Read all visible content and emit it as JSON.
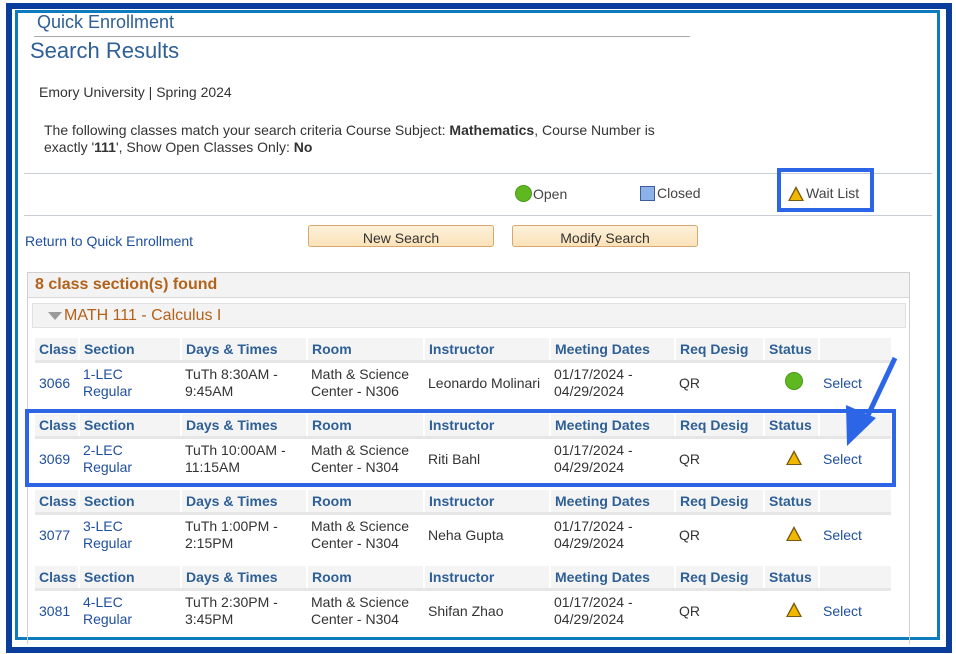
{
  "header": {
    "app_title": "Quick Enrollment",
    "page_title": "Search Results",
    "institution_term": "Emory University | Spring 2024"
  },
  "criteria": {
    "prefix": "The following classes match your search criteria Course Subject: ",
    "subject": "Mathematics",
    "mid": ",  Course Number is exactly '",
    "course_number": "111",
    "mid2": "',  Show Open Classes Only: ",
    "open_only": "No"
  },
  "legend": {
    "open": {
      "label": "Open",
      "icon": "green-circle-icon",
      "color": "#5fb820"
    },
    "closed": {
      "label": "Closed",
      "icon": "blue-square-icon",
      "color": "#8db2e8"
    },
    "waitlist": {
      "label": "Wait List",
      "icon": "yellow-triangle-icon",
      "color": "#f2b800"
    }
  },
  "actions": {
    "return_link": "Return to Quick Enrollment",
    "new_search": "New Search",
    "modify_search": "Modify Search"
  },
  "results": {
    "count_label": "8 class section(s) found",
    "course_title": "MATH 111 - Calculus I",
    "columns": [
      "Class",
      "Section",
      "Days & Times",
      "Room",
      "Instructor",
      "Meeting Dates",
      "Req Desig",
      "Status",
      ""
    ],
    "sections": [
      {
        "class_nbr": "3066",
        "section_1": "1-LEC",
        "section_2": "Regular",
        "times_1": "TuTh 8:30AM -",
        "times_2": "9:45AM",
        "room_1": "Math & Science",
        "room_2": "Center - N306",
        "instructor": "Leonardo Molinari",
        "dates_1": "01/17/2024 -",
        "dates_2": "04/29/2024",
        "req_desig": "QR",
        "status": "Open",
        "select": "Select"
      },
      {
        "class_nbr": "3069",
        "section_1": "2-LEC",
        "section_2": "Regular",
        "times_1": "TuTh 10:00AM -",
        "times_2": "11:15AM",
        "room_1": "Math & Science",
        "room_2": "Center - N304",
        "instructor": "Riti Bahl",
        "dates_1": "01/17/2024 -",
        "dates_2": "04/29/2024",
        "req_desig": "QR",
        "status": "Wait List",
        "select": "Select"
      },
      {
        "class_nbr": "3077",
        "section_1": "3-LEC",
        "section_2": "Regular",
        "times_1": "TuTh 1:00PM -",
        "times_2": "2:15PM",
        "room_1": "Math & Science",
        "room_2": "Center - N304",
        "instructor": "Neha Gupta",
        "dates_1": "01/17/2024 -",
        "dates_2": "04/29/2024",
        "req_desig": "QR",
        "status": "Wait List",
        "select": "Select"
      },
      {
        "class_nbr": "3081",
        "section_1": "4-LEC",
        "section_2": "Regular",
        "times_1": "TuTh 2:30PM -",
        "times_2": "3:45PM",
        "room_1": "Math & Science",
        "room_2": "Center - N304",
        "instructor": "Shifan Zhao",
        "dates_1": "01/17/2024 -",
        "dates_2": "04/29/2024",
        "req_desig": "QR",
        "status": "Wait List",
        "select": "Select"
      }
    ]
  },
  "annotations": {
    "highlight_color": "#2c66e6",
    "highlighted_legend": "Wait List",
    "highlighted_class": "3069"
  }
}
